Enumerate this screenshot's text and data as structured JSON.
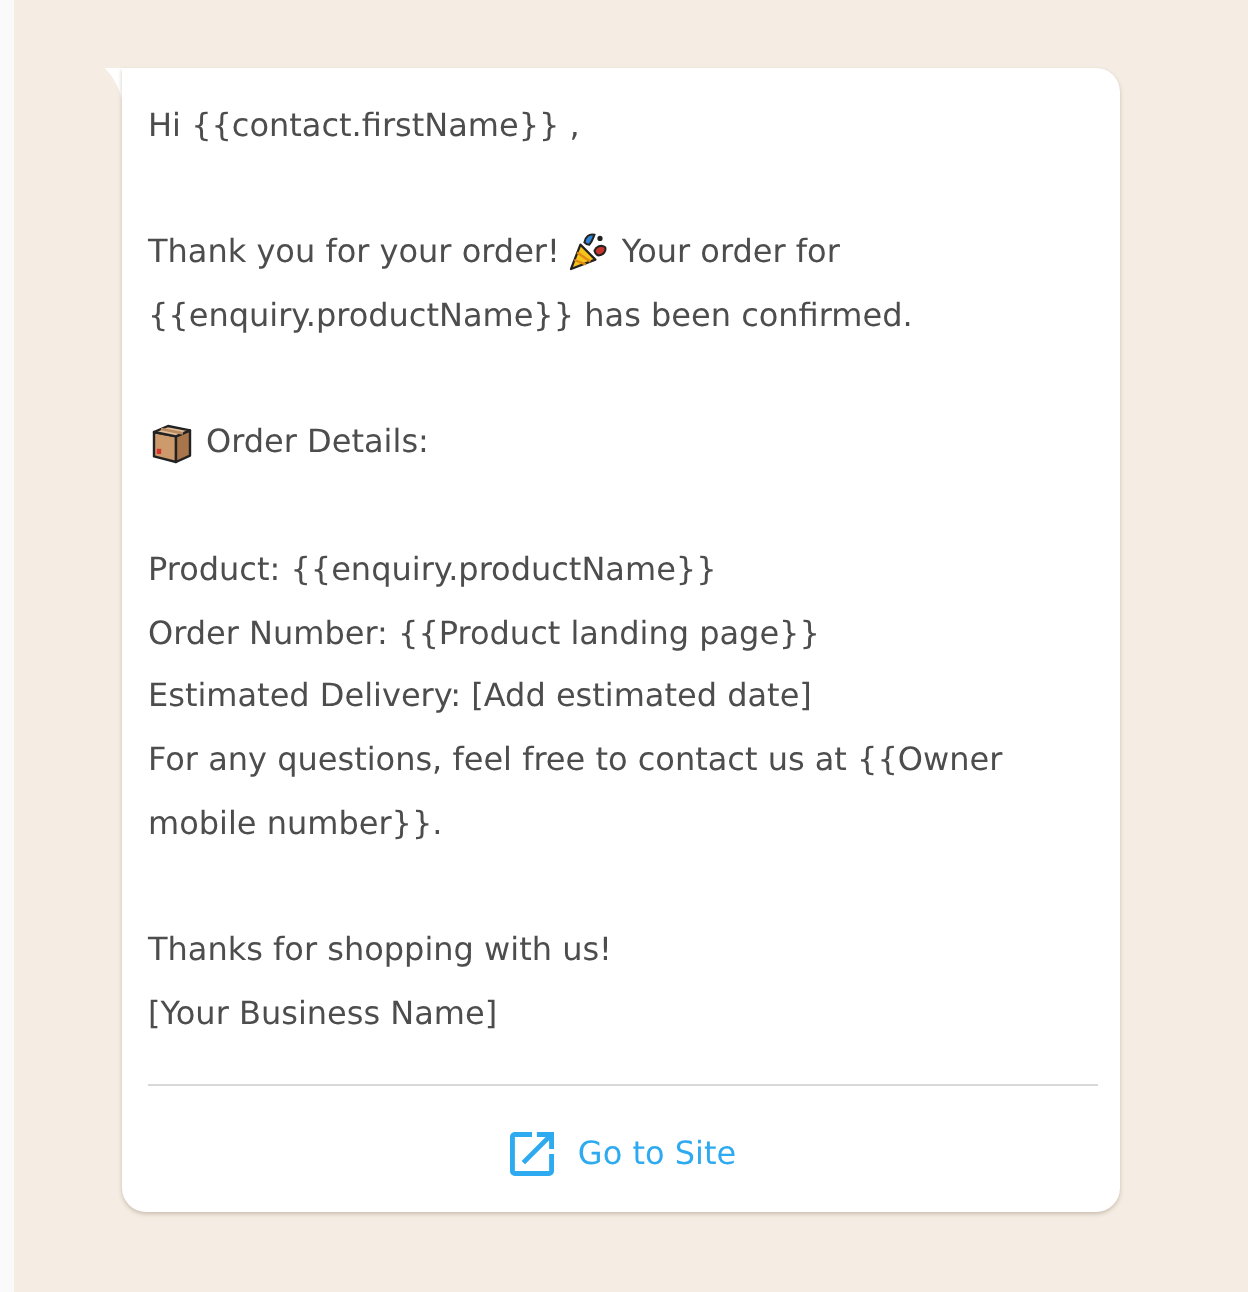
{
  "message": {
    "paragraphs": [
      {
        "lines": [
          [
            {
              "kind": "text",
              "text": "Hi {{contact.firstName}} ,"
            }
          ]
        ]
      },
      {
        "lines": [
          [
            {
              "kind": "text",
              "text": "Thank you for your order!"
            },
            {
              "kind": "popper"
            },
            {
              "kind": "text",
              "text": "Your order for"
            }
          ],
          [
            {
              "kind": "text",
              "text": "{{enquiry.productName}} has been confirmed."
            }
          ]
        ]
      },
      {
        "lines": [
          [
            {
              "kind": "package"
            },
            {
              "kind": "text",
              "text": "Order Details:"
            }
          ]
        ]
      },
      {
        "lines": [
          [
            {
              "kind": "text",
              "text": "Product: {{enquiry.productName}}"
            }
          ],
          [
            {
              "kind": "text",
              "text": "Order Number: {{Product landing page}}"
            }
          ],
          [
            {
              "kind": "text",
              "text": "Estimated Delivery: [Add estimated date]"
            }
          ],
          [
            {
              "kind": "text",
              "text": "For any questions, feel free to contact us at {{Owner"
            }
          ],
          [
            {
              "kind": "text",
              "text": "mobile number}}."
            }
          ]
        ]
      },
      {
        "lines": [
          [
            {
              "kind": "text",
              "text": "Thanks for shopping with us!"
            }
          ],
          [
            {
              "kind": "text",
              "text": "[Your Business Name]"
            }
          ]
        ]
      }
    ]
  },
  "link": {
    "label": "Go to Site"
  }
}
